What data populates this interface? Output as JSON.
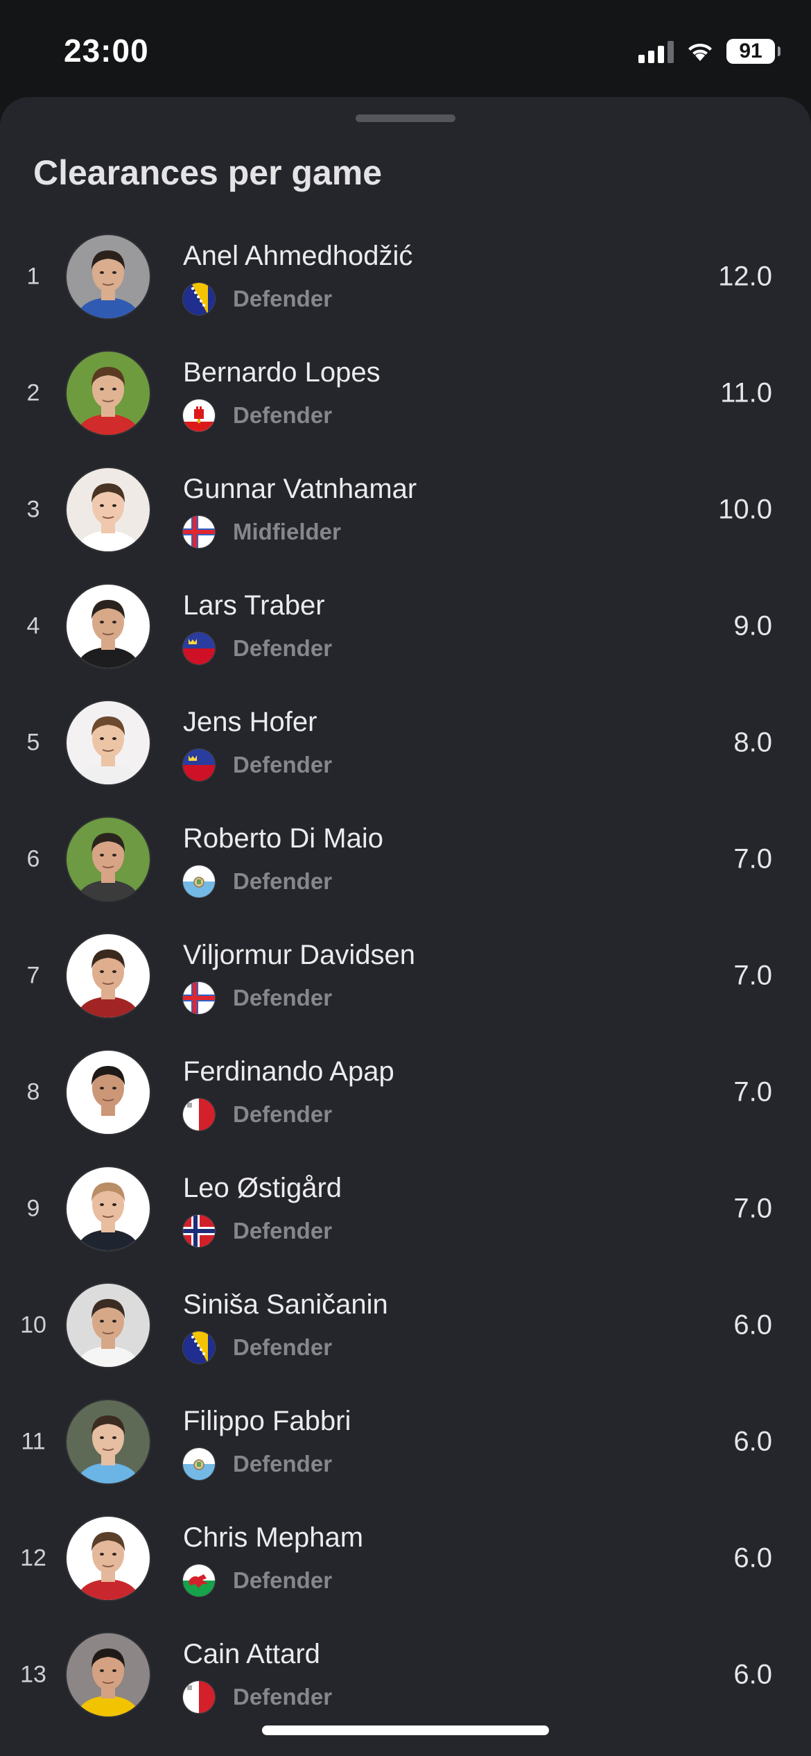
{
  "status_bar": {
    "time": "23:00",
    "battery": "91",
    "signal_bars": 4,
    "signal_bars_on": 3,
    "wifi": "wifi-icon"
  },
  "sheet": {
    "title": "Clearances per game"
  },
  "players": [
    {
      "rank": "1",
      "name": "Anel Ahmedhodžić",
      "position": "Defender",
      "value": "12.0",
      "flag": "bosnia",
      "avatar_bg": "#9a9a9c",
      "skin": "#d9ad8e",
      "hair": "#2b211b",
      "shirt": "#2f5bb3"
    },
    {
      "rank": "2",
      "name": "Bernardo Lopes",
      "position": "Defender",
      "value": "11.0",
      "flag": "gibraltar",
      "avatar_bg": "#6f9b3f",
      "skin": "#e0b493",
      "hair": "#5a3a22",
      "shirt": "#d22b2b"
    },
    {
      "rank": "3",
      "name": "Gunnar Vatnhamar",
      "position": "Midfielder",
      "value": "10.0",
      "flag": "faroe",
      "avatar_bg": "#efeae6",
      "skin": "#efc8ad",
      "hair": "#4a3424",
      "shirt": "#ffffff"
    },
    {
      "rank": "4",
      "name": "Lars Traber",
      "position": "Defender",
      "value": "9.0",
      "flag": "liechtenstein",
      "avatar_bg": "#ffffff",
      "skin": "#d8a988",
      "hair": "#2a221d",
      "shirt": "#1d1d1f"
    },
    {
      "rank": "5",
      "name": "Jens Hofer",
      "position": "Defender",
      "value": "8.0",
      "flag": "liechtenstein",
      "avatar_bg": "#f4f1f2",
      "skin": "#ecc4a6",
      "hair": "#6b4a2e",
      "shirt": "#f0f0f0"
    },
    {
      "rank": "6",
      "name": "Roberto Di Maio",
      "position": "Defender",
      "value": "7.0",
      "flag": "sanmarino",
      "avatar_bg": "#6d9a42",
      "skin": "#d8a486",
      "hair": "#2b241e",
      "shirt": "#3b3b3b"
    },
    {
      "rank": "7",
      "name": "Viljormur Davidsen",
      "position": "Defender",
      "value": "7.0",
      "flag": "faroe",
      "avatar_bg": "#ffffff",
      "skin": "#deae8e",
      "hair": "#3a2a1e",
      "shirt": "#a32424"
    },
    {
      "rank": "8",
      "name": "Ferdinando Apap",
      "position": "Defender",
      "value": "7.0",
      "flag": "malta",
      "avatar_bg": "#ffffff",
      "skin": "#cc9776",
      "hair": "#1e1a17",
      "shirt": "#ffffff"
    },
    {
      "rank": "9",
      "name": "Leo Østigård",
      "position": "Defender",
      "value": "7.0",
      "flag": "norway",
      "avatar_bg": "#ffffff",
      "skin": "#e8bda0",
      "hair": "#b98d66",
      "shirt": "#1e2430"
    },
    {
      "rank": "10",
      "name": "Siniša Saničanin",
      "position": "Defender",
      "value": "6.0",
      "flag": "bosnia",
      "avatar_bg": "#dcdcdc",
      "skin": "#d6a888",
      "hair": "#3a2c22",
      "shirt": "#f5f5f5"
    },
    {
      "rank": "11",
      "name": "Filippo Fabbri",
      "position": "Defender",
      "value": "6.0",
      "flag": "sanmarino",
      "avatar_bg": "#5e6a56",
      "skin": "#e6bea2",
      "hair": "#3b2b20",
      "shirt": "#6ab4e6"
    },
    {
      "rank": "12",
      "name": "Chris Mepham",
      "position": "Defender",
      "value": "6.0",
      "flag": "wales",
      "avatar_bg": "#ffffff",
      "skin": "#e4b89a",
      "hair": "#5a3f2a",
      "shirt": "#c8272d"
    },
    {
      "rank": "13",
      "name": "Cain Attard",
      "position": "Defender",
      "value": "6.0",
      "flag": "malta",
      "avatar_bg": "#8c8686",
      "skin": "#d4a282",
      "hair": "#1f1a17",
      "shirt": "#f2c300"
    }
  ]
}
